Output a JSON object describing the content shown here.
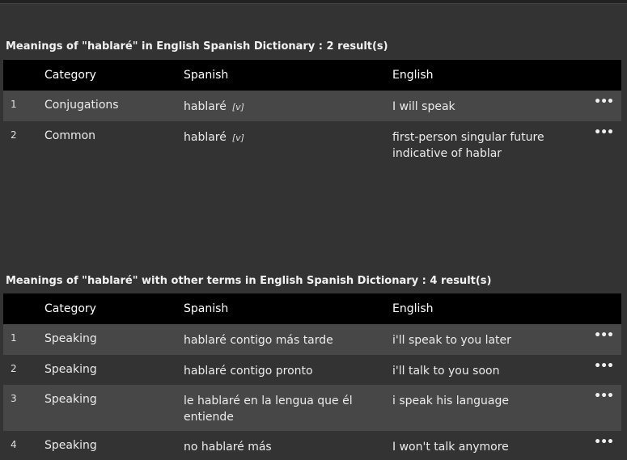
{
  "section1": {
    "title": "Meanings of \"hablaré\" in English Spanish Dictionary : 2 result(s)",
    "headers": {
      "category": "Category",
      "spanish": "Spanish",
      "english": "English"
    },
    "rows": [
      {
        "num": "1",
        "category": "Conjugations",
        "spanish": "hablaré",
        "pos": "[v]",
        "english": "I will speak",
        "more": "•••"
      },
      {
        "num": "2",
        "category": "Common",
        "spanish": "hablaré",
        "pos": "[v]",
        "english": "first-person singular future indicative of hablar",
        "more": "•••"
      }
    ]
  },
  "section2": {
    "title": "Meanings of \"hablaré\" with other terms in English Spanish Dictionary : 4 result(s)",
    "headers": {
      "category": "Category",
      "spanish": "Spanish",
      "english": "English"
    },
    "rows": [
      {
        "num": "1",
        "category": "Speaking",
        "spanish": "hablaré contigo más tarde",
        "english": "i'll speak to you later",
        "more": "•••"
      },
      {
        "num": "2",
        "category": "Speaking",
        "spanish": "hablaré contigo pronto",
        "english": "i'll talk to you soon",
        "more": "•••"
      },
      {
        "num": "3",
        "category": "Speaking",
        "spanish": "le hablaré en la lengua que él entiende",
        "english": "i speak his language",
        "more": "•••"
      },
      {
        "num": "4",
        "category": "Speaking",
        "spanish": "no hablaré más",
        "english": "I won't talk anymore",
        "more": "•••"
      }
    ]
  }
}
